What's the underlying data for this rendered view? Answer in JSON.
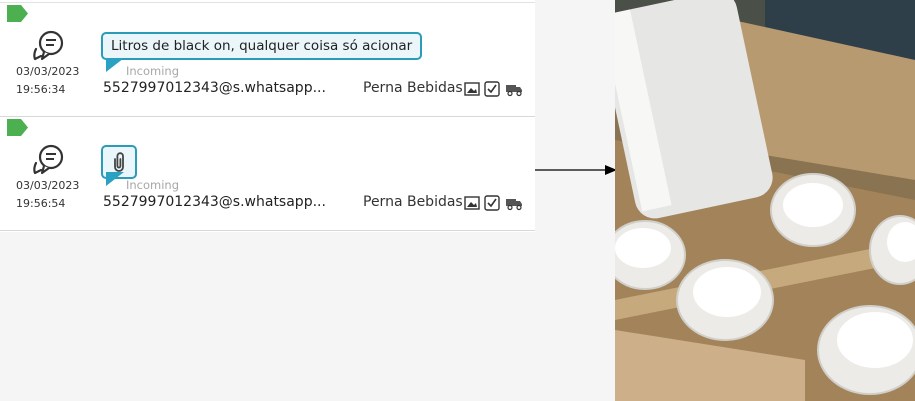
{
  "messages": [
    {
      "date": "03/03/2023",
      "time": "19:56:34",
      "text": "Litros de black on, qualquer coisa só acionar",
      "direction": "Incoming",
      "sender": "5527997012343@s.whatsapp...",
      "contact": "Perna Bebidas"
    },
    {
      "date": "03/03/2023",
      "time": "19:56:54",
      "attachment_icon": "paperclip-icon",
      "direction": "Incoming",
      "sender": "5527997012343@s.whatsapp...",
      "contact": "Perna Bebidas"
    }
  ],
  "colors": {
    "flag": "#4caf50",
    "bubble_border": "#2a9bb8",
    "bubble_bg": "#eaf6fa",
    "tail": "#2aa0c2",
    "incoming_text": "#a7a7a7"
  },
  "icons": [
    "flag-icon",
    "chat-bubbles-icon",
    "image-icon",
    "checkbox-icon",
    "truck-icon",
    "paperclip-icon",
    "arrow-right-icon"
  ]
}
